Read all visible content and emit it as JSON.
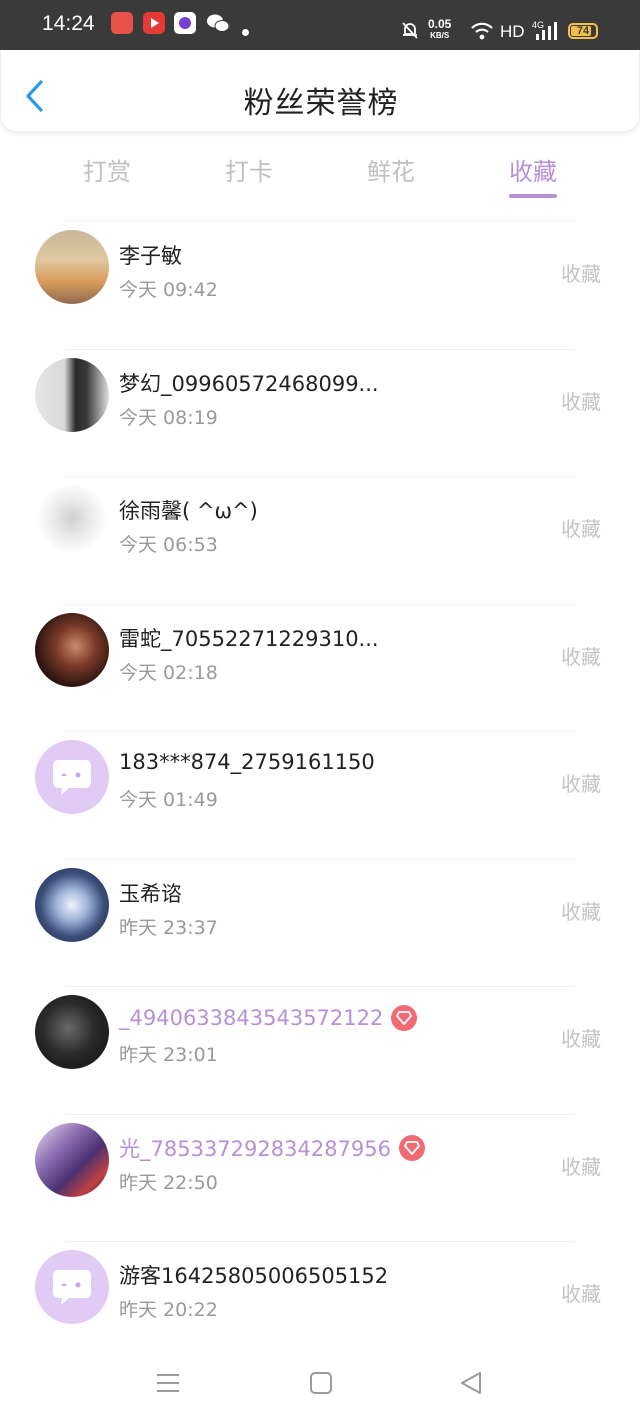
{
  "status_bar": {
    "time": "14:24",
    "net_speed": "0.05",
    "net_unit": "KB/S",
    "hd": "HD",
    "signal": "4G",
    "battery": "74"
  },
  "header": {
    "title": "粉丝荣誉榜"
  },
  "tabs": [
    {
      "label": "打赏",
      "active": false
    },
    {
      "label": "打卡",
      "active": false
    },
    {
      "label": "鲜花",
      "active": false
    },
    {
      "label": "收藏",
      "active": true
    }
  ],
  "list": [
    {
      "name": "李子敏",
      "time": "今天 09:42",
      "action": "收藏",
      "vip": false,
      "avatar": "sunset-photo"
    },
    {
      "name": "梦幻_09960572468099...",
      "time": "今天 08:19",
      "action": "收藏",
      "vip": false,
      "avatar": "person-photo"
    },
    {
      "name": "徐雨馨( ^ω^)",
      "time": "今天 06:53",
      "action": "收藏",
      "vip": false,
      "avatar": "figure-drawing"
    },
    {
      "name": "雷蛇_70552271229310...",
      "time": "今天 02:18",
      "action": "收藏",
      "vip": false,
      "avatar": "anime-portrait"
    },
    {
      "name": "183***874_2759161150",
      "time": "今天 01:49",
      "action": "收藏",
      "vip": false,
      "avatar": "default-chat-avatar"
    },
    {
      "name": "玉希谘",
      "time": "昨天 23:37",
      "action": "收藏",
      "vip": false,
      "avatar": "fantasy-art"
    },
    {
      "name": "_4940633843543572122",
      "time": "昨天 23:01",
      "action": "收藏",
      "vip": true,
      "avatar": "dark-anime-portrait"
    },
    {
      "name": "光_785337292834287956",
      "time": "昨天 22:50",
      "action": "收藏",
      "vip": true,
      "avatar": "game-character"
    },
    {
      "name": "游客16425805006505152",
      "time": "昨天 20:22",
      "action": "收藏",
      "vip": false,
      "avatar": "default-chat-avatar"
    }
  ],
  "colors": {
    "accent": "#b98fd6",
    "back_arrow": "#2a9be8",
    "badge": "#f26b73",
    "status_bar_bg": "#3a3a3a"
  }
}
